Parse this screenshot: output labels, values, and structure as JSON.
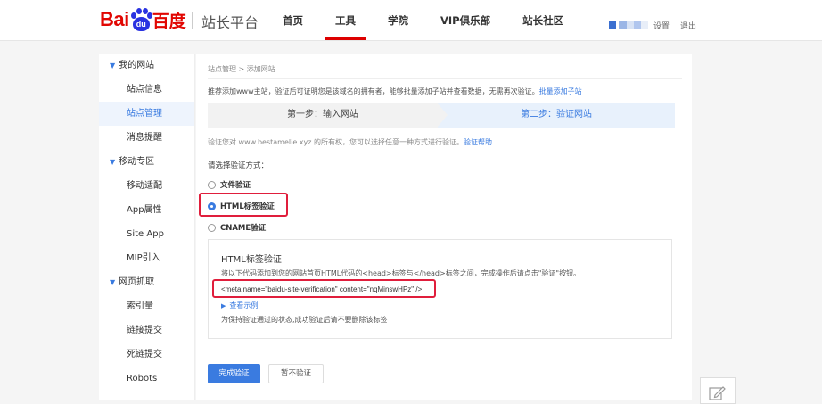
{
  "header": {
    "logo_bai": "Bai",
    "logo_du": "du",
    "logo_cn": "百度",
    "platform": "站长平台",
    "nav": [
      {
        "label": "首页",
        "active": false
      },
      {
        "label": "工具",
        "active": true
      },
      {
        "label": "学院",
        "active": false
      },
      {
        "label": "VIP俱乐部",
        "active": false
      },
      {
        "label": "站长社区",
        "active": false
      }
    ],
    "settings": "设置",
    "logout": "退出"
  },
  "sidebar": {
    "groups": [
      {
        "label": "我的网站",
        "items": [
          "站点信息",
          "站点管理",
          "消息提醒"
        ],
        "active": "站点管理"
      },
      {
        "label": "移动专区",
        "items": [
          "移动适配",
          "App属性",
          "Site App",
          "MIP引入"
        ]
      },
      {
        "label": "网页抓取",
        "items": [
          "索引量",
          "链接提交",
          "死链提交",
          "Robots"
        ]
      }
    ]
  },
  "main": {
    "breadcrumb": "站点管理 > 添加网站",
    "intro": "推荐添加www主站，验证后可证明您是该域名的拥有者，能够批量添加子站并查看数据，无需再次验证。",
    "intro_link": "批量添加子站",
    "step1": "第一步：输入网站",
    "step2": "第二步：验证网站",
    "verify_note": "验证您对 www.bestamelie.xyz 的所有权，您可以选择任意一种方式进行验证。",
    "verify_help": "验证帮助",
    "choose_label": "请选择验证方式：",
    "options": [
      {
        "label": "文件验证",
        "selected": false
      },
      {
        "label": "HTML标签验证",
        "selected": true
      },
      {
        "label": "CNAME验证",
        "selected": false
      }
    ],
    "box": {
      "title": "HTML标签验证",
      "desc": "将以下代码添加到您的网站首页HTML代码的<head>标签与</head>标签之间，完成操作后请点击\"验证\"按钮。",
      "code": "<meta name=\"baidu-site-verification\" content=\"nqMinswHPz\" />",
      "example": "查看示例",
      "keep": "为保持验证通过的状态,成功验证后请不要删除该标签"
    },
    "btn_done": "完成验证",
    "btn_skip": "暂不验证"
  },
  "colors": {
    "brand_red": "#e10602",
    "accent_blue": "#3a7be0",
    "highlight": "#e01e3c"
  }
}
